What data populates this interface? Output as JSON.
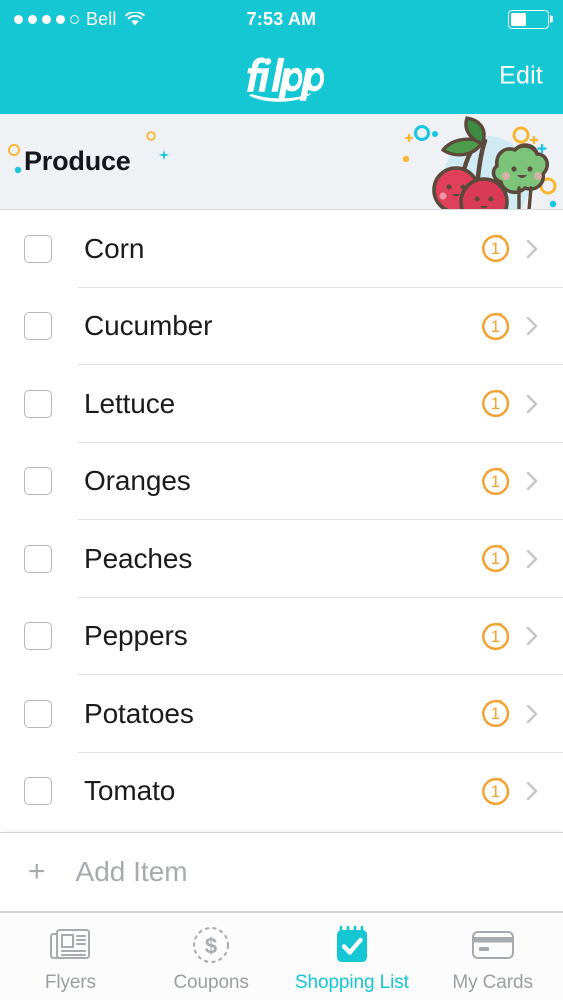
{
  "status_bar": {
    "carrier": "Bell",
    "signal_dots_filled": 4,
    "signal_dots_total": 5,
    "wifi_icon": "wifi-icon",
    "time": "7:53 AM",
    "battery_icon": "battery-icon",
    "battery_level_percent": 42
  },
  "nav_bar": {
    "logo_text": "flipp",
    "logo_icon": "flipp-logo",
    "edit_label": "Edit",
    "background_color": "#15C7D3"
  },
  "category_header": {
    "title": "Produce",
    "art_icon": "produce-illustration-cherries-broccoli",
    "background_color": "#EFF1F4",
    "sparkle_colors": [
      "#F7B733",
      "#19C6E0"
    ]
  },
  "list": {
    "checkbox_icon": "unchecked-checkbox-icon",
    "quantity_badge_icon": "quantity-ring-icon",
    "chevron_icon": "chevron-right-icon",
    "items": [
      {
        "label": "Corn",
        "quantity": "1",
        "checked": false
      },
      {
        "label": "Cucumber",
        "quantity": "1",
        "checked": false
      },
      {
        "label": "Lettuce",
        "quantity": "1",
        "checked": false
      },
      {
        "label": "Oranges",
        "quantity": "1",
        "checked": false
      },
      {
        "label": "Peaches",
        "quantity": "1",
        "checked": false
      },
      {
        "label": "Peppers",
        "quantity": "1",
        "checked": false
      },
      {
        "label": "Potatoes",
        "quantity": "1",
        "checked": false
      },
      {
        "label": "Tomato",
        "quantity": "1",
        "checked": false
      }
    ]
  },
  "add_item": {
    "plus_icon": "plus-icon",
    "placeholder": "Add Item",
    "value": ""
  },
  "tab_bar": {
    "active_color": "#15C7D3",
    "inactive_color": "#9B9FA4",
    "tabs": [
      {
        "label": "Flyers",
        "icon": "newspaper-icon",
        "active": false
      },
      {
        "label": "Coupons",
        "icon": "dollar-circle-icon",
        "active": false
      },
      {
        "label": "Shopping List",
        "icon": "checklist-pad-icon",
        "active": true
      },
      {
        "label": "My Cards",
        "icon": "credit-card-icon",
        "active": false
      }
    ]
  }
}
